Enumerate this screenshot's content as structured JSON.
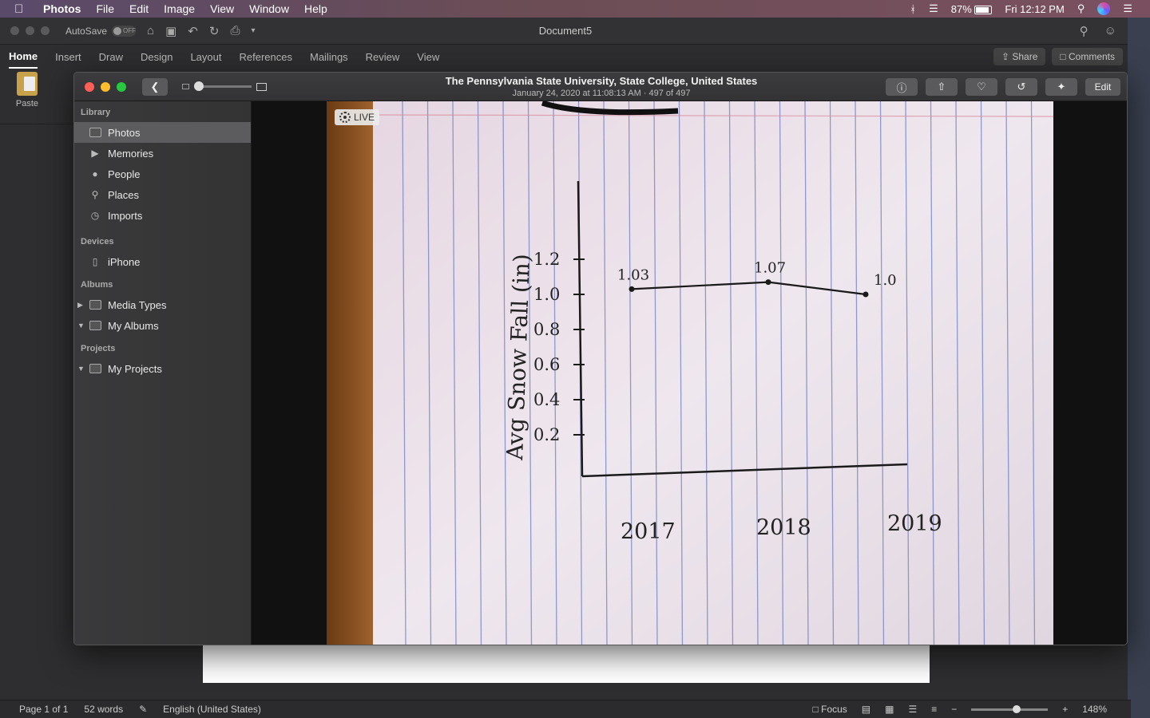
{
  "menubar": {
    "app": "Photos",
    "items": [
      "File",
      "Edit",
      "Image",
      "View",
      "Window",
      "Help"
    ],
    "battery": "87%",
    "battery_level": 0.87,
    "clock": "Fri 12:12 PM"
  },
  "word": {
    "autosave_label": "AutoSave",
    "autosave_state": "OFF",
    "doc_title": "Document5",
    "tabs": [
      "Home",
      "Insert",
      "Draw",
      "Design",
      "Layout",
      "References",
      "Mailings",
      "Review",
      "View"
    ],
    "share_label": "Share",
    "comments_label": "Comments",
    "paste_label": "Paste",
    "status": {
      "page": "Page 1 of 1",
      "words": "52 words",
      "language": "English (United States)",
      "focus": "Focus",
      "zoom": "148%"
    }
  },
  "photos": {
    "title": "The Pennsylvania State University, State College, United States",
    "subtitle": "January 24, 2020 at 11:08:13 AM  ·  497 of 497",
    "edit_label": "Edit",
    "live_label": "LIVE",
    "sidebar": {
      "library_header": "Library",
      "library": [
        {
          "label": "Photos",
          "icon": "photos-icon",
          "selected": true
        },
        {
          "label": "Memories",
          "icon": "memories-icon"
        },
        {
          "label": "People",
          "icon": "person-icon"
        },
        {
          "label": "Places",
          "icon": "pin-icon"
        },
        {
          "label": "Imports",
          "icon": "clock-icon"
        }
      ],
      "devices_header": "Devices",
      "devices": [
        {
          "label": "iPhone",
          "icon": "iphone-icon"
        }
      ],
      "albums_header": "Albums",
      "albums": [
        {
          "label": "Media Types",
          "icon": "folder-icon",
          "expanded": false
        },
        {
          "label": "My Albums",
          "icon": "folder-icon",
          "expanded": true
        }
      ],
      "projects_header": "Projects",
      "projects": [
        {
          "label": "My Projects",
          "icon": "folder-icon",
          "expanded": true
        }
      ]
    }
  },
  "chart_data": {
    "type": "line",
    "ylabel": "Avg Snow Fall (in)",
    "yticks": [
      "1.2",
      "1.0",
      "0.8",
      "0.6",
      "0.4",
      "0.2"
    ],
    "categories": [
      "2017",
      "2018",
      "2019"
    ],
    "values": [
      1.03,
      1.07,
      1.0
    ],
    "labels": [
      "1.03",
      "1.07",
      "1.0"
    ]
  }
}
